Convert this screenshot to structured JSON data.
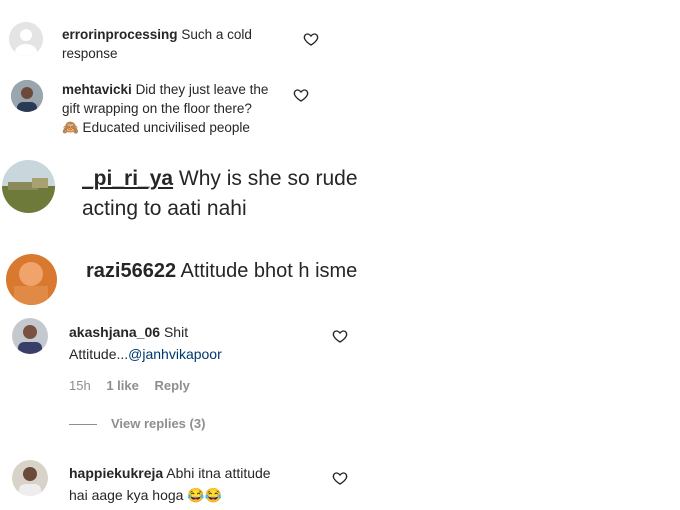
{
  "comments": [
    {
      "username": "errorinprocessing",
      "line1": "Such a cold",
      "line2": "response"
    },
    {
      "username": "mehtavicki",
      "line1": "Did they just leave the",
      "line2": "gift wrapping on the floor there?",
      "line3": "🙈 Educated uncivilised people"
    },
    {
      "username": "_pi_ri_ya",
      "line1": "Why is she so rude",
      "line2": "acting to aati nahi"
    },
    {
      "username": "razi56622",
      "line1": "Attitude bhot h isme"
    },
    {
      "username": "akashjana_06",
      "line1": "Shit",
      "line2_prefix": "Attitude...",
      "mention": "@janhvikapoor",
      "time": "15h",
      "likes": "1 like",
      "reply": "Reply",
      "view_replies": "View replies (3)"
    },
    {
      "username": "happiekukreja",
      "line1": "Abhi itna attitude",
      "line2": "hai aage kya hoga 😂😂"
    }
  ],
  "icons": {
    "like": "heart-outline-icon",
    "avatar_default": "default-avatar-icon"
  },
  "colors": {
    "text": "#262626",
    "muted": "#8e8e8e",
    "mention": "#00376b"
  }
}
